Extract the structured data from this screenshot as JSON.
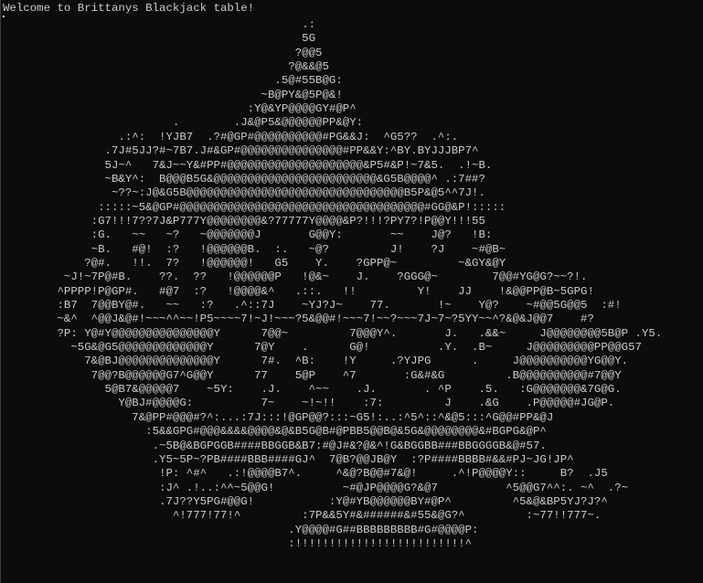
{
  "console": {
    "welcome": "Welcome to Brittanys Blackjack table!",
    "art_lines": [
      "                                            .:",
      "                                            5G",
      "                                           ?@@5",
      "                                          ?@&&@5",
      "                                        .5@#55B@G:",
      "                                      ~B@PY&@5P@&!",
      "                                    :Y@&YP@@@@GY#@P^",
      "                         .        .J&@P5&@@@@@@PP&@Y:",
      "                 .:^:  !YJB7  .?#@GP#@@@@@@@@@@#PG&&J:  ^G5??  .^:.",
      "               .7J#5JJ?#~7B7.J#&GP#@@@@@@@@@@@@@@@#PP&&Y:^BY.BYJJJBP7^",
      "               5J~^   7&J~~Y&#PP#@@@@@@@@@@@@@@@@@@@@&P5#&P!~7&5.  .!~B.",
      "               ~B&Y^:  B@@@B5G&@@@@@@@@@@@@@@@@@@@@@@@@&G5B@@@@^ .:7##?",
      "                ~??~:J@&G5B@@@@@@@@@@@@@@@@@@@@@@@@@@@@@@@@B5P&@5^^7J!.",
      "              :::::~5&@GP#@@@@@@@@@@@@@@@@@@@@@@@@@@@@@@@@@@@@#GG@&P!:::::",
      "             :G7!!!7??7J&P777Y@@@@@@@@&?77777Y@@@@&P?!!!?PY7?!P@@Y!!!55",
      "             :G.   ~~   ~?   ~@@@@@@@J       G@@Y:       ~~    J@?   !B:",
      "             ~B.   #@!  :?   !@@@@@@B.  :.   ~@?         J!    ?J    ~#@B~",
      "            ?@#.   !!.  7?   !@@@@@@!   G5    Y.    ?GPP@~         ~&GY&@Y",
      "         ~J!~7P@#B.    ??.  ??   !@@@@@@P   !@&~    J.    ?GGG@~        7@@#YG@G?~~?!.",
      "        ^PPPP!P@GP#.   #@7  :?   !@@@@&^   .::.   !!         Y!    JJ    !&@@PP@B~5GPG!",
      "        :B7  7@@BY@#.   ~~   :?   .^::7J    ~YJ?J~    77.       !~    Y@?    ~#@@5G@@5  :#!",
      "        ~&^  ^@@J&@#!~~~^^~~!P5~~~~7!~J!~~~?5&@@#!~~~7!~~?~~~7J~7~?5YY~~^?&@&J@@7    #?",
      "        ?P: Y@#Y@@@@@@@@@@@@@@@Y      7@@~         7@@@Y^.       J.   .&&~     J@@@@@@@@5B@P .Y5.",
      "          ~5G&@G5@@@@@@@@@@@@@Y      7@Y    .      G@!          .Y.  .B~     J@@@@@@@@@PP@@G57",
      "            7&@BJ@@@@@@@@@@@@@@Y      7#.  ^B:    !Y     .?YJPG      .     J@@@@@@@@@@YG@@Y.",
      "             7@@?B@@@@@@G7^G@@Y      77    5@P    ^7       :G&#&G         .B@@@@@@@@@@#7@@Y",
      "               5@B7&@@@@@7    ~5Y:    .J.    ^~~    .J.       . ^P    .5.   :G@@@@@@@&7G@G.",
      "                 Y@BJ#@@@@G:          7~    ~!~!!    :7:         J    .&G    .P@@@@@#JG@P.",
      "                   7&@PP#@@@#?^:...:7J:::!@GP@@?:::~G5!:..:^5^::^&@5:::^G@@#PP&@J",
      "                     :5&&GPG#@@@&&&&@@@@&@&B5G@B#@PBB5@@B@&5G&@@@@@@@@&#BGPG&@P^",
      "                      .~5B@&BGPGGB####BBGGB&B7:#@J#&?@&^!G&BGGBB###BBGGGGB&@#57.",
      "                      .Y5~5P~?PB####BBB####GJ^  7@B?@@JB@Y  :?P####BBBB#&&#PJ~JG!JP^",
      "                       !P: ^#^   .:!@@@@B7^.     ^&@?B@@#7&@!     .^!P@@@@Y::     B?  .J5",
      "                       :J^ .!..:^^~5@@G!          ~#@JP@@@@G?&@7          ^5@@G7^^:. ~^  .?~",
      "                       .7J??Y5PG#@@G!           :Y@#YB@@@@@@BY#@P^         ^5&@&BP5YJ?J?^",
      "                         ^!777!77!^         :7P&&5Y#&######&#55&@G?^         :~77!!777~.",
      "                                          .Y@@@@#G##BBBBBBBBB#G#@@@@P:",
      "                                          :!!!!!!!!!!!!!!!!!!!!!!!!!^"
    ]
  }
}
